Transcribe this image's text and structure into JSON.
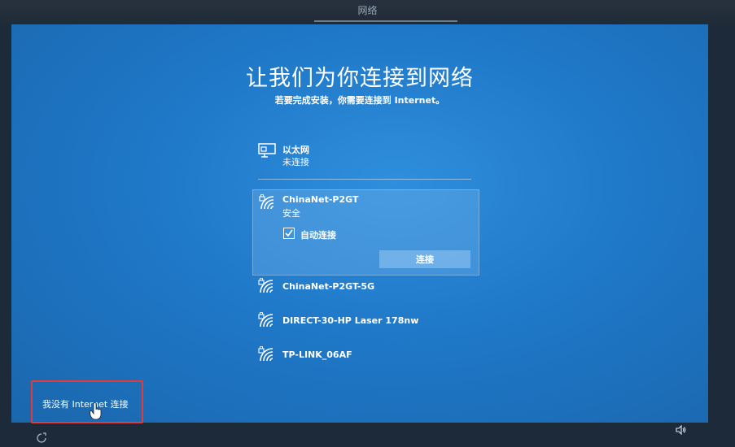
{
  "window": {
    "title": "网络"
  },
  "oobe": {
    "title": "让我们为你连接到网络",
    "subtitle": "若要完成安装，你需要连接到 Internet。"
  },
  "ethernet": {
    "name": "以太网",
    "status": "未连接",
    "icon": "ethernet-icon"
  },
  "selected_network": {
    "name": "ChinaNet-P2GT",
    "status": "安全",
    "auto_connect_label": "自动连接",
    "auto_connect_checked": true,
    "connect_label": "连接",
    "icon": "wifi-secured-icon"
  },
  "networks": [
    {
      "name": "ChinaNet-P2GT-5G",
      "icon": "wifi-secured-icon"
    },
    {
      "name": "DIRECT-30-HP Laser 178nw",
      "icon": "wifi-secured-icon"
    },
    {
      "name": "TP-LINK_06AF",
      "icon": "wifi-secured-icon"
    }
  ],
  "footer": {
    "no_internet_label": "我没有 Internet 连接",
    "accessibility_icon": "accessibility-icon",
    "volume_icon": "volume-icon"
  },
  "colors": {
    "background": "#1f78c8",
    "highlight_border": "#e33a3a"
  }
}
